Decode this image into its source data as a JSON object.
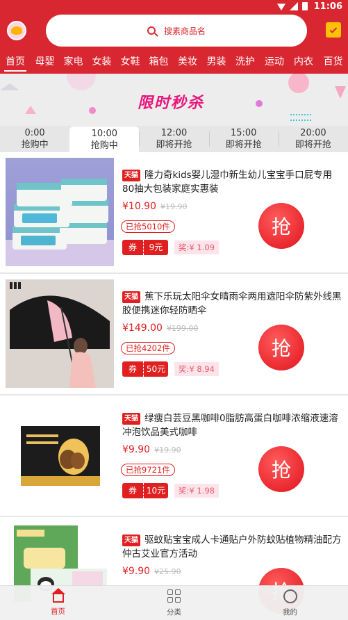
{
  "status": {
    "time": "11:06"
  },
  "header": {
    "search_placeholder": "搜素商品名"
  },
  "categories": [
    "首页",
    "母婴",
    "家电",
    "女装",
    "女鞋",
    "箱包",
    "美妆",
    "男装",
    "洗护",
    "运动",
    "内衣",
    "百货"
  ],
  "banner": {
    "title": "限时秒杀"
  },
  "timeslots": [
    {
      "time": "0:00",
      "status": "抢购中"
    },
    {
      "time": "10:00",
      "status": "抢购中"
    },
    {
      "time": "12:00",
      "status": "即将开抢"
    },
    {
      "time": "15:00",
      "status": "即将开抢"
    },
    {
      "time": "20:00",
      "status": "即将开抢"
    }
  ],
  "products": [
    {
      "badge": "天猫",
      "title": "隆力奇kids婴儿湿巾新生幼儿宝宝手口屁专用80抽大包装家庭实惠装",
      "price": "¥10.90",
      "original": "¥19.90",
      "sold": "已抢5010件",
      "coupon_label": "券",
      "coupon_value": "9元",
      "reward": "奖:¥ 1.09",
      "grab": "抢"
    },
    {
      "badge": "天猫",
      "title": "蕉下乐玩太阳伞女晴雨伞两用遮阳伞防紫外线黑胶便携迷你轻防晒伞",
      "price": "¥149.00",
      "original": "¥199.00",
      "sold": "已抢4202件",
      "coupon_label": "券",
      "coupon_value": "50元",
      "reward": "奖:¥ 8.94",
      "grab": "抢"
    },
    {
      "badge": "天猫",
      "title": "绿瘦白芸豆黑咖啡0脂肪高蛋白咖啡浓缩液速溶冲泡饮品美式咖啡",
      "price": "¥9.90",
      "original": "¥19.90",
      "sold": "已抢9721件",
      "coupon_label": "券",
      "coupon_value": "10元",
      "reward": "奖:¥ 1.98",
      "grab": "抢"
    },
    {
      "badge": "天猫",
      "title": "驱蚊贴宝宝成人卡通贴户外防蚊贴植物精油配方仲古艾业官方活动",
      "price": "¥9.90",
      "original": "¥25.90",
      "grab": "抢"
    }
  ],
  "tabbar": {
    "home": "首页",
    "category": "分类",
    "mine": "我的"
  },
  "colors": {
    "brand": "#d92731",
    "accent": "#e02020",
    "flash": "#e8147a"
  }
}
